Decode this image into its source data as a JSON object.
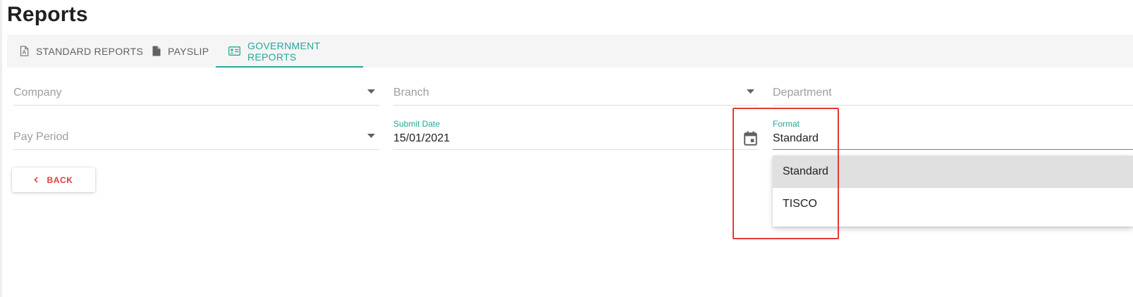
{
  "page": {
    "title": "Reports"
  },
  "tabs": [
    {
      "label": "STANDARD REPORTS",
      "icon": "pdf-file-icon",
      "active": false
    },
    {
      "label": "PAYSLIP",
      "icon": "document-icon",
      "active": false
    },
    {
      "label": "GOVERNMENT REPORTS",
      "icon": "id-card-icon",
      "active": true
    }
  ],
  "form": {
    "company": {
      "placeholder": "Company"
    },
    "branch": {
      "placeholder": "Branch"
    },
    "department": {
      "placeholder": "Department"
    },
    "pay_period": {
      "placeholder": "Pay Period"
    },
    "submit_date": {
      "label": "Submit Date",
      "value": "15/01/2021",
      "icon": "calendar-icon"
    },
    "format": {
      "label": "Format",
      "value": "Standard",
      "options": [
        "Standard",
        "TISCO"
      ],
      "selected_index": 0
    }
  },
  "back_button": {
    "label": "BACK",
    "icon": "chevron-left-icon"
  },
  "colors": {
    "accent": "#26a69a",
    "danger": "#e53935",
    "tabbar_bg": "#f5f5f5",
    "selected_option_bg": "#e0e0e0"
  }
}
